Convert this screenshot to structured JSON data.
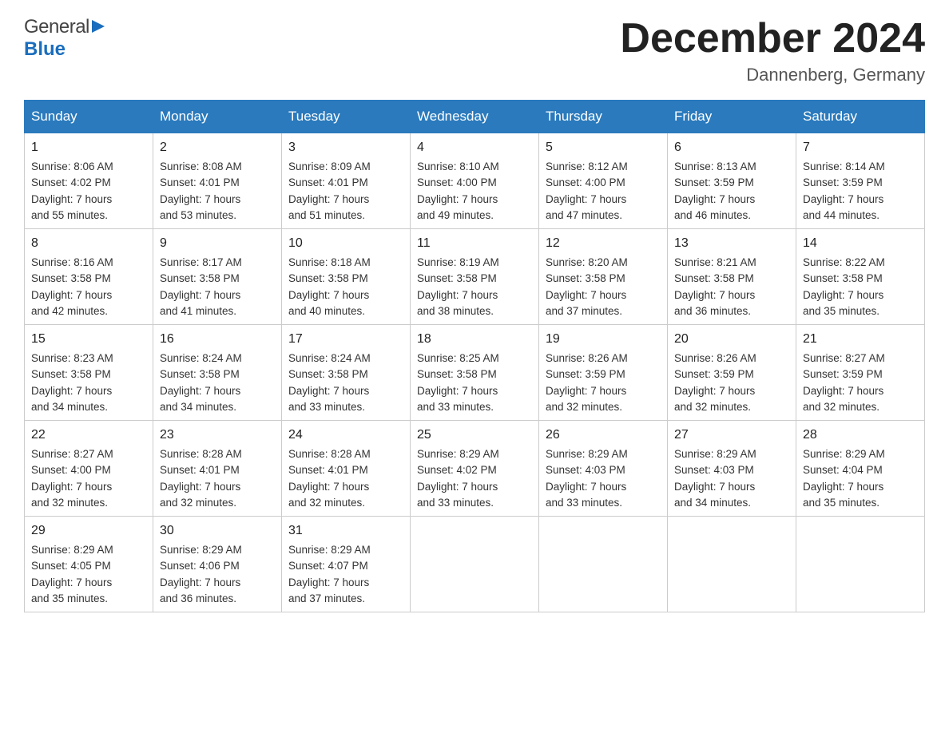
{
  "header": {
    "title": "December 2024",
    "location": "Dannenberg, Germany",
    "logo_general": "General",
    "logo_blue": "Blue"
  },
  "days_of_week": [
    "Sunday",
    "Monday",
    "Tuesday",
    "Wednesday",
    "Thursday",
    "Friday",
    "Saturday"
  ],
  "weeks": [
    [
      {
        "day": "1",
        "info": "Sunrise: 8:06 AM\nSunset: 4:02 PM\nDaylight: 7 hours\nand 55 minutes."
      },
      {
        "day": "2",
        "info": "Sunrise: 8:08 AM\nSunset: 4:01 PM\nDaylight: 7 hours\nand 53 minutes."
      },
      {
        "day": "3",
        "info": "Sunrise: 8:09 AM\nSunset: 4:01 PM\nDaylight: 7 hours\nand 51 minutes."
      },
      {
        "day": "4",
        "info": "Sunrise: 8:10 AM\nSunset: 4:00 PM\nDaylight: 7 hours\nand 49 minutes."
      },
      {
        "day": "5",
        "info": "Sunrise: 8:12 AM\nSunset: 4:00 PM\nDaylight: 7 hours\nand 47 minutes."
      },
      {
        "day": "6",
        "info": "Sunrise: 8:13 AM\nSunset: 3:59 PM\nDaylight: 7 hours\nand 46 minutes."
      },
      {
        "day": "7",
        "info": "Sunrise: 8:14 AM\nSunset: 3:59 PM\nDaylight: 7 hours\nand 44 minutes."
      }
    ],
    [
      {
        "day": "8",
        "info": "Sunrise: 8:16 AM\nSunset: 3:58 PM\nDaylight: 7 hours\nand 42 minutes."
      },
      {
        "day": "9",
        "info": "Sunrise: 8:17 AM\nSunset: 3:58 PM\nDaylight: 7 hours\nand 41 minutes."
      },
      {
        "day": "10",
        "info": "Sunrise: 8:18 AM\nSunset: 3:58 PM\nDaylight: 7 hours\nand 40 minutes."
      },
      {
        "day": "11",
        "info": "Sunrise: 8:19 AM\nSunset: 3:58 PM\nDaylight: 7 hours\nand 38 minutes."
      },
      {
        "day": "12",
        "info": "Sunrise: 8:20 AM\nSunset: 3:58 PM\nDaylight: 7 hours\nand 37 minutes."
      },
      {
        "day": "13",
        "info": "Sunrise: 8:21 AM\nSunset: 3:58 PM\nDaylight: 7 hours\nand 36 minutes."
      },
      {
        "day": "14",
        "info": "Sunrise: 8:22 AM\nSunset: 3:58 PM\nDaylight: 7 hours\nand 35 minutes."
      }
    ],
    [
      {
        "day": "15",
        "info": "Sunrise: 8:23 AM\nSunset: 3:58 PM\nDaylight: 7 hours\nand 34 minutes."
      },
      {
        "day": "16",
        "info": "Sunrise: 8:24 AM\nSunset: 3:58 PM\nDaylight: 7 hours\nand 34 minutes."
      },
      {
        "day": "17",
        "info": "Sunrise: 8:24 AM\nSunset: 3:58 PM\nDaylight: 7 hours\nand 33 minutes."
      },
      {
        "day": "18",
        "info": "Sunrise: 8:25 AM\nSunset: 3:58 PM\nDaylight: 7 hours\nand 33 minutes."
      },
      {
        "day": "19",
        "info": "Sunrise: 8:26 AM\nSunset: 3:59 PM\nDaylight: 7 hours\nand 32 minutes."
      },
      {
        "day": "20",
        "info": "Sunrise: 8:26 AM\nSunset: 3:59 PM\nDaylight: 7 hours\nand 32 minutes."
      },
      {
        "day": "21",
        "info": "Sunrise: 8:27 AM\nSunset: 3:59 PM\nDaylight: 7 hours\nand 32 minutes."
      }
    ],
    [
      {
        "day": "22",
        "info": "Sunrise: 8:27 AM\nSunset: 4:00 PM\nDaylight: 7 hours\nand 32 minutes."
      },
      {
        "day": "23",
        "info": "Sunrise: 8:28 AM\nSunset: 4:01 PM\nDaylight: 7 hours\nand 32 minutes."
      },
      {
        "day": "24",
        "info": "Sunrise: 8:28 AM\nSunset: 4:01 PM\nDaylight: 7 hours\nand 32 minutes."
      },
      {
        "day": "25",
        "info": "Sunrise: 8:29 AM\nSunset: 4:02 PM\nDaylight: 7 hours\nand 33 minutes."
      },
      {
        "day": "26",
        "info": "Sunrise: 8:29 AM\nSunset: 4:03 PM\nDaylight: 7 hours\nand 33 minutes."
      },
      {
        "day": "27",
        "info": "Sunrise: 8:29 AM\nSunset: 4:03 PM\nDaylight: 7 hours\nand 34 minutes."
      },
      {
        "day": "28",
        "info": "Sunrise: 8:29 AM\nSunset: 4:04 PM\nDaylight: 7 hours\nand 35 minutes."
      }
    ],
    [
      {
        "day": "29",
        "info": "Sunrise: 8:29 AM\nSunset: 4:05 PM\nDaylight: 7 hours\nand 35 minutes."
      },
      {
        "day": "30",
        "info": "Sunrise: 8:29 AM\nSunset: 4:06 PM\nDaylight: 7 hours\nand 36 minutes."
      },
      {
        "day": "31",
        "info": "Sunrise: 8:29 AM\nSunset: 4:07 PM\nDaylight: 7 hours\nand 37 minutes."
      },
      {
        "day": "",
        "info": ""
      },
      {
        "day": "",
        "info": ""
      },
      {
        "day": "",
        "info": ""
      },
      {
        "day": "",
        "info": ""
      }
    ]
  ]
}
